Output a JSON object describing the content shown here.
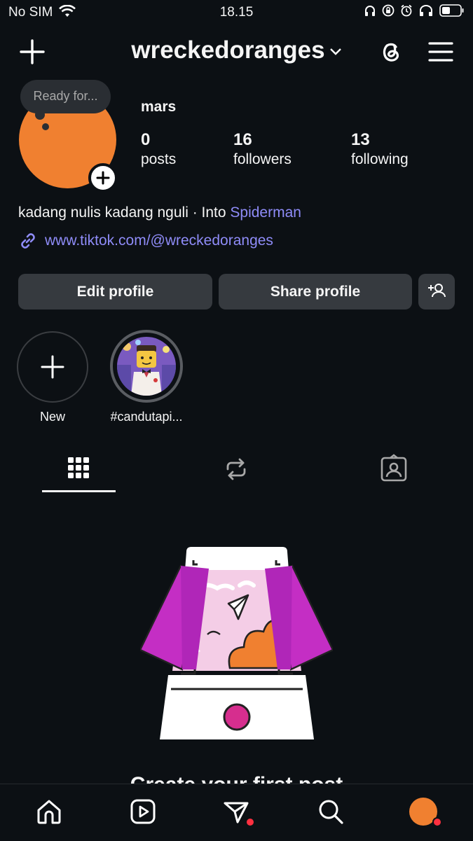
{
  "status": {
    "carrier": "No SIM",
    "time": "18.15"
  },
  "header": {
    "username": "wreckedoranges"
  },
  "profile": {
    "note": "Ready for...",
    "display_name": "mars",
    "posts": {
      "count": "0",
      "label": "posts"
    },
    "followers": {
      "count": "16",
      "label": "followers"
    },
    "following": {
      "count": "13",
      "label": "following"
    },
    "bio_prefix": "kadang nulis kadang nguli · Into ",
    "bio_highlight": "Spiderman",
    "link": "www.tiktok.com/@wreckedoranges"
  },
  "actions": {
    "edit": "Edit profile",
    "share": "Share profile"
  },
  "highlights": [
    {
      "label": "New"
    },
    {
      "label": "#candutapi..."
    }
  ],
  "tabs": [
    "grid-icon",
    "reposts-icon",
    "tagged-icon"
  ],
  "empty_state": {
    "cta": "Create your first post"
  },
  "nav": [
    "home-icon",
    "reels-icon",
    "messages-icon",
    "search-icon",
    "profile-avatar"
  ],
  "colors": {
    "accent": "#8f8cf8",
    "avatar": "#f08030",
    "background": "#0c1014",
    "notification": "#ff3040"
  }
}
